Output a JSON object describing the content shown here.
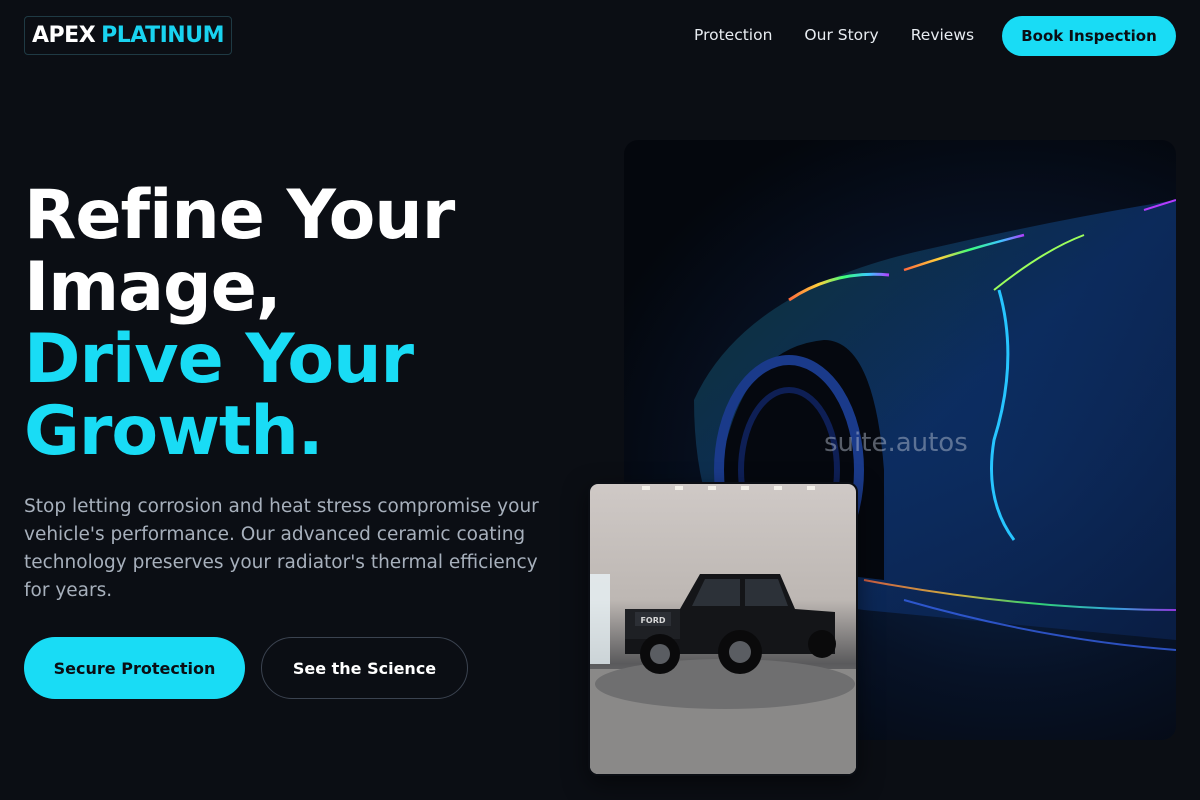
{
  "brand": {
    "part1": "APEX",
    "part2": "PLATINUM"
  },
  "nav": {
    "items": [
      "Protection",
      "Our Story",
      "Reviews"
    ],
    "cta": "Book Inspection"
  },
  "hero": {
    "line1": "Refine Your",
    "line2": "Image,",
    "line3": "Drive Your",
    "line4": "Growth.",
    "subtitle": "Stop letting corrosion and heat stress compromise your vehicle's performance. Our advanced ceramic coating technology preserves your radiator's thermal efficiency for years.",
    "primary_cta": "Secure Protection",
    "secondary_cta": "See the Science"
  },
  "media": {
    "watermark": "suite.autos",
    "truck_badge": "FORD"
  },
  "colors": {
    "accent": "#19dcf5",
    "background": "#0b0e14"
  }
}
